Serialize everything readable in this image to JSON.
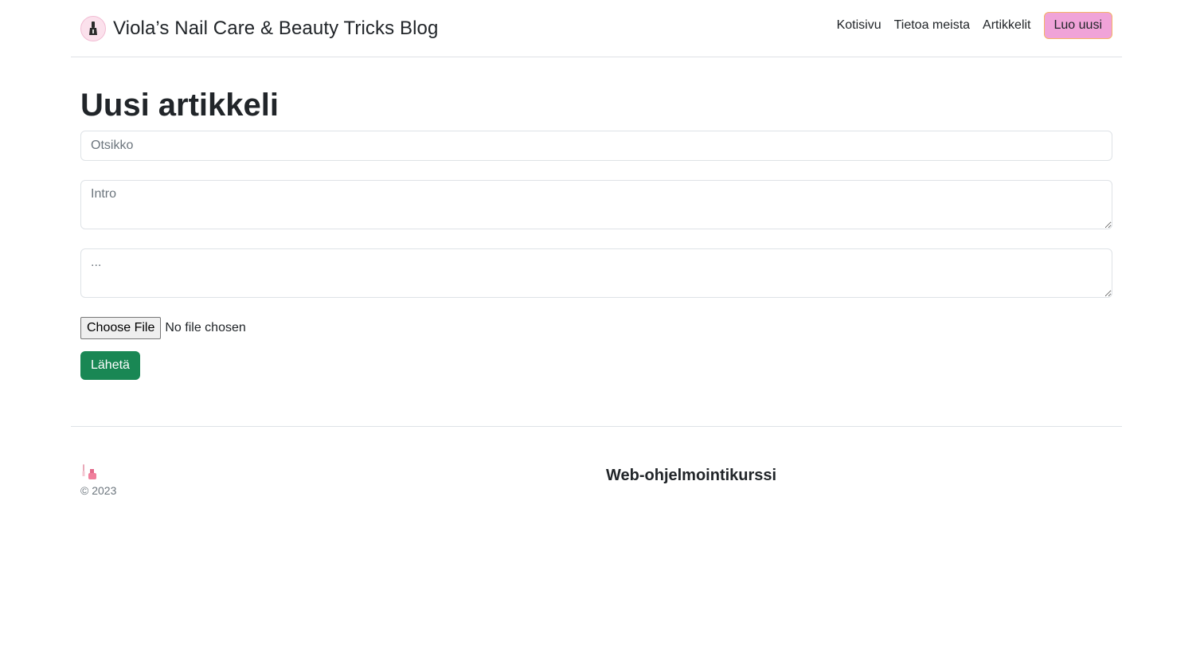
{
  "header": {
    "brand_title": "Viola’s Nail Care & Beauty Tricks Blog",
    "brand_icon": "nail-polish-icon",
    "nav": {
      "home": "Kotisivu",
      "about": "Tietoa meista",
      "articles": "Artikkelit",
      "create_new": "Luo uusi"
    }
  },
  "main": {
    "title": "Uusi artikkeli",
    "title_placeholder": "Otsikko",
    "intro_placeholder": "Intro",
    "content_placeholder": "...",
    "file_button": "Choose File",
    "file_status": "No file chosen",
    "submit": "Lähetä"
  },
  "footer": {
    "icon": "nail-polish-bottle-icon",
    "copyright": "© 2023",
    "heading": "Web-ohjelmointikurssi"
  },
  "colors": {
    "accent_button": "#f0a3d8",
    "accent_border": "#f4b266",
    "submit": "#198754"
  }
}
